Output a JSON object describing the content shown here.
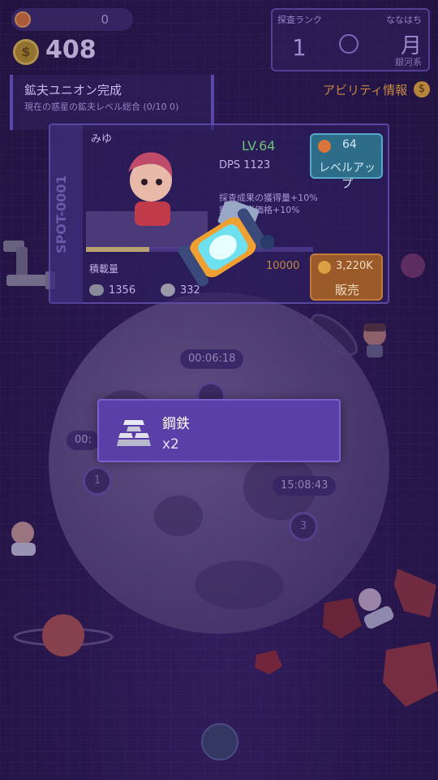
{
  "top": {
    "resource_value": "0",
    "gold": "408"
  },
  "rank": {
    "label": "探査ランク",
    "value": "1",
    "planet_label": "ななはち",
    "planet_name": "月",
    "planet_system": "銀河系"
  },
  "mission": {
    "title": "鉱夫ユニオン完成",
    "description": "現在の惑星の鉱夫レベル総合 (0/10 0)"
  },
  "ability_link": "アビリティ情報",
  "spot": {
    "id": "SPOT-0001",
    "character_name": "みゆ",
    "level": "LV.64",
    "dps": "DPS 1123",
    "bonus_line1": "採査成果の獲得量+10%",
    "bonus_line2": "鉱石販売価格+10%",
    "bonus_line3": "+10%",
    "levelup_cost": "64",
    "levelup_label": "レベルアップ",
    "cargo_label": "積載量",
    "cargo_total": "10000",
    "cargo_fill": 0.28,
    "ore1_count": "1356",
    "ore2_count": "332",
    "sell_value": "3,220K",
    "sell_label": "販売"
  },
  "timers": {
    "t1": "00:06:18",
    "t2": "00:",
    "t3": "15:08:43"
  },
  "spots": {
    "s1": "1",
    "s3": "3"
  },
  "popup": {
    "item_name": "鋼鉄",
    "quantity": "x2"
  },
  "icons": {
    "item": "steel-ingot-icon",
    "canister": "energy-canister-icon",
    "coin": "coin-icon"
  },
  "colors": {
    "background": "#2a1a4a",
    "popup": "#5a3fa8",
    "levelup": "#2e6d8a",
    "sell": "#9a5a2a",
    "level_text": "#6fbf7a"
  }
}
